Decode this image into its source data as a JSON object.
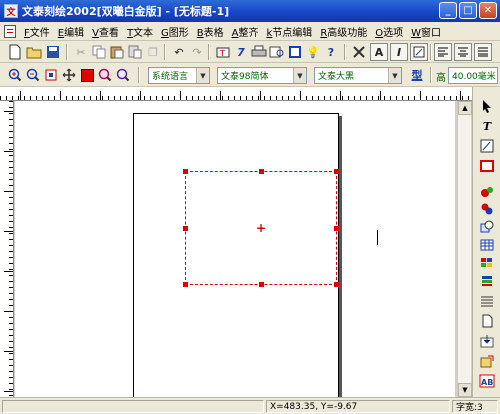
{
  "window": {
    "title": "文泰刻绘2002[双曦白金版] - [无标题-1]",
    "app_icon": "文",
    "controls": {
      "minimize": "_",
      "maximize": "□",
      "close": "✕"
    }
  },
  "menu": [
    {
      "key": "F",
      "label": "文件"
    },
    {
      "key": "E",
      "label": "编辑"
    },
    {
      "key": "V",
      "label": "查看"
    },
    {
      "key": "T",
      "label": "文本"
    },
    {
      "key": "G",
      "label": "图形"
    },
    {
      "key": "B",
      "label": "表格"
    },
    {
      "key": "A",
      "label": "整齐"
    },
    {
      "key": "k",
      "label": "节点编辑"
    },
    {
      "key": "R",
      "label": "高级功能"
    },
    {
      "key": "O",
      "label": "选项"
    },
    {
      "key": "W",
      "label": "窗口"
    }
  ],
  "toolbar2": {
    "font_set": "系统语言",
    "font_name": "文泰98简体",
    "font_style": "文泰大黑",
    "shape_button": "型",
    "height_label": "高",
    "height_value": "40.00毫米"
  },
  "status": {
    "coords": "X=483.35, Y=-9.67",
    "char_width": "字宽:3"
  },
  "colors": {
    "selection": "#dd0000",
    "title_bar": "#1747c8",
    "accent_green": "#006400"
  }
}
